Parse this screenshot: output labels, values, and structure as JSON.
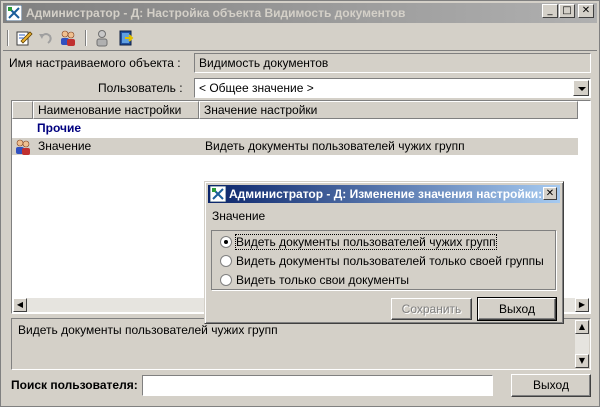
{
  "window": {
    "title": "Администратор - Д: Настройка объекта Видимость документов",
    "controls": {
      "minimize": "_",
      "maximize": "□",
      "close": "✕"
    }
  },
  "toolbar": {
    "icons": [
      "edit-icon",
      "undo-icon",
      "users-icon",
      "user-icon",
      "exit-icon"
    ]
  },
  "form": {
    "object_label": "Имя настраиваемого объекта :",
    "object_value": "Видимость документов",
    "user_label": "Пользователь :",
    "user_value": "< Общее значение >"
  },
  "grid": {
    "columns": [
      "Наименование настройки",
      "Значение настройки"
    ],
    "group": "Прочие",
    "rows": [
      {
        "name": "Значение",
        "value": "Видеть документы пользователей чужих групп"
      }
    ]
  },
  "memo": {
    "text": "Видеть документы пользователей чужих групп"
  },
  "search": {
    "label": "Поиск пользователя:",
    "value": "",
    "button": "Выход"
  },
  "dialog": {
    "title": "Администратор - Д:  Изменение значения настройки:",
    "group_label": "Значение",
    "options": [
      "Видеть документы пользователей чужих групп",
      "Видеть документы пользователей только своей группы",
      "Видеть только свои документы"
    ],
    "selected_index": 0,
    "save_button": "Сохранить",
    "exit_button": "Выход",
    "close": "✕"
  },
  "colors": {
    "inactive_title": "#808080",
    "active_title": "#0a246a",
    "group_text": "#00007f",
    "face": "#d4d0c8"
  }
}
